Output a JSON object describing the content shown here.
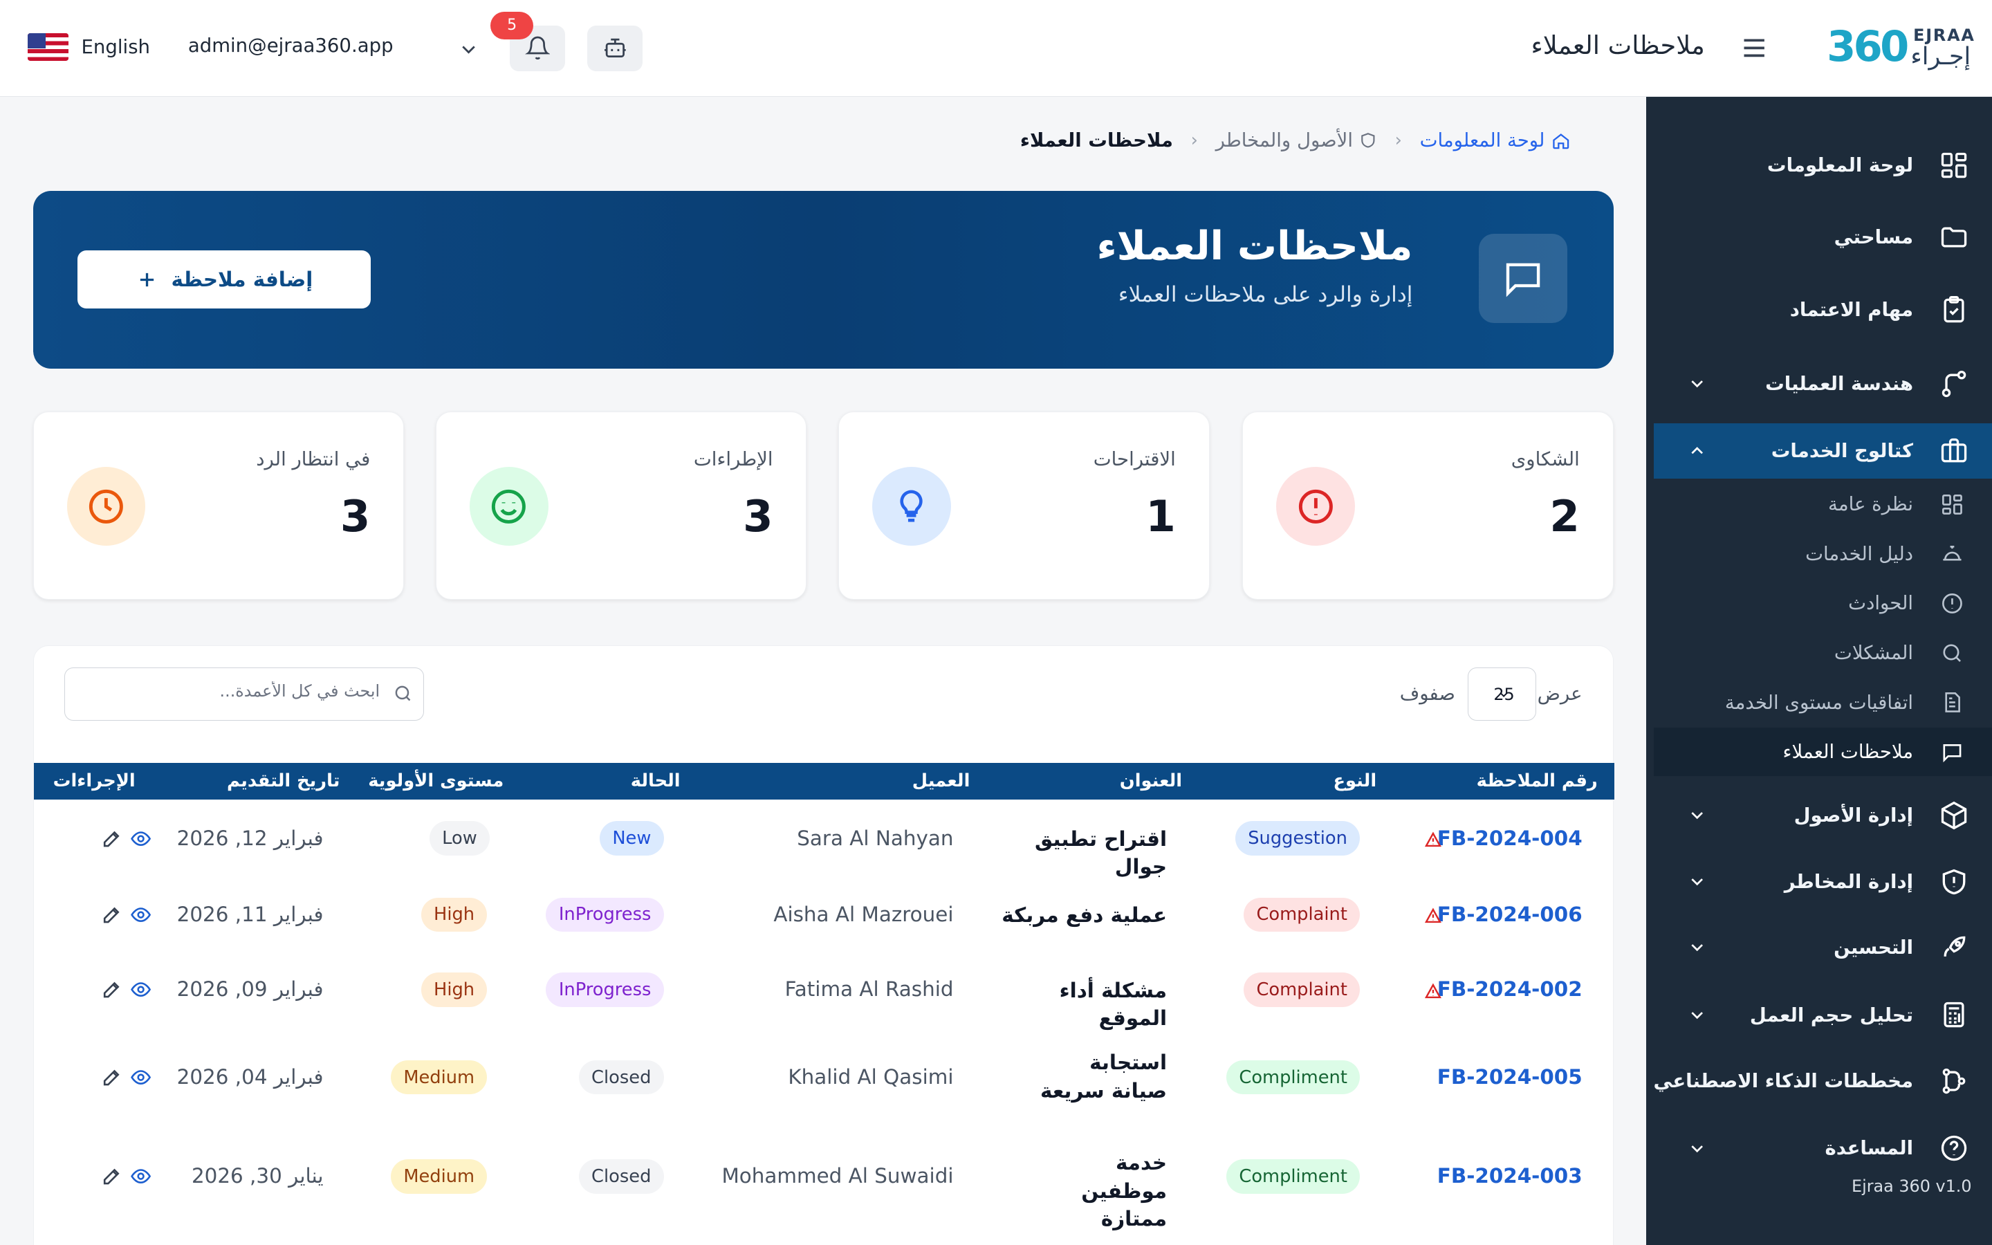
{
  "header": {
    "language": "English",
    "user_email": "admin@ejraa360.app",
    "notifications_count": "5",
    "page_title": "ملاحظات العملاء",
    "logo": {
      "number": "360",
      "en": "EJRAA",
      "ar": "إجـراء"
    }
  },
  "breadcrumb": {
    "home": "لوحة المعلومات",
    "middle": "الأصول والمخاطر",
    "current": "ملاحظات العملاء"
  },
  "hero": {
    "title": "ملاحظات العملاء",
    "subtitle": "إدارة والرد على ملاحظات العملاء",
    "add_button": "إضافة ملاحظة"
  },
  "stats": [
    {
      "label": "الشكاوى",
      "value": "2",
      "icon": "alert-circle-icon",
      "color": "#dc2626",
      "bg": "#fee2e2"
    },
    {
      "label": "الاقتراحات",
      "value": "1",
      "icon": "lightbulb-icon",
      "color": "#2563eb",
      "bg": "#dbeafe"
    },
    {
      "label": "الإطراءات",
      "value": "3",
      "icon": "smile-icon",
      "color": "#16a34a",
      "bg": "#dcfce7"
    },
    {
      "label": "في انتظار الرد",
      "value": "3",
      "icon": "clock-icon",
      "color": "#ea580c",
      "bg": "#ffedd5"
    }
  ],
  "table": {
    "show_label": "عرض",
    "rows_per_page": "25",
    "rows_label": "صفوف",
    "search_placeholder": "ابحث في كل الأعمدة...",
    "columns": [
      "رقم الملاحظة",
      "النوع",
      "العنوان",
      "العميل",
      "الحالة",
      "مستوى الأولوية",
      "تاريخ التقديم",
      "الإجراءات"
    ],
    "rows": [
      {
        "id": "FB-2024-004",
        "warning": true,
        "type": "Suggestion",
        "title": "اقتراح تطبيق جوال",
        "client": "Sara Al Nahyan",
        "status": "New",
        "priority": "Low",
        "date": "فبراير 12, 2026"
      },
      {
        "id": "FB-2024-006",
        "warning": true,
        "type": "Complaint",
        "title": "عملية دفع مربكة",
        "client": "Aisha Al Mazrouei",
        "status": "InProgress",
        "priority": "High",
        "date": "فبراير 11, 2026"
      },
      {
        "id": "FB-2024-002",
        "warning": true,
        "type": "Complaint",
        "title": "مشكلة أداء الموقع",
        "client": "Fatima Al Rashid",
        "status": "InProgress",
        "priority": "High",
        "date": "فبراير 09, 2026"
      },
      {
        "id": "FB-2024-005",
        "warning": false,
        "type": "Compliment",
        "title": "استجابة صيانة سريعة",
        "client": "Khalid Al Qasimi",
        "status": "Closed",
        "priority": "Medium",
        "date": "فبراير 04, 2026"
      },
      {
        "id": "FB-2024-003",
        "warning": false,
        "type": "Compliment",
        "title": "خدمة موظفين ممتازة",
        "client": "Mohammed Al Suwaidi",
        "status": "Closed",
        "priority": "Medium",
        "date": "يناير 30, 2026"
      }
    ]
  },
  "sidebar": {
    "items": [
      {
        "label": "لوحة المعلومات",
        "icon": "dashboard-icon"
      },
      {
        "label": "مساحتي",
        "icon": "folder-icon"
      },
      {
        "label": "مهام الاعتماد",
        "icon": "clipboard-check-icon"
      },
      {
        "label": "هندسة العمليات",
        "icon": "workflow-icon"
      },
      {
        "label": "كتالوج الخدمات",
        "icon": "briefcase-icon"
      },
      {
        "label": "إدارة الأصول",
        "icon": "box-icon"
      },
      {
        "label": "إدارة المخاطر",
        "icon": "shield-icon"
      },
      {
        "label": "التحسين",
        "icon": "rocket-icon"
      },
      {
        "label": "تحليل حجم العمل",
        "icon": "calculator-icon"
      },
      {
        "label": "مخططات الذكاء الاصطناعي",
        "icon": "ai-diagram-icon"
      },
      {
        "label": "المساعدة",
        "icon": "help-icon"
      }
    ],
    "subitems": [
      {
        "label": "نظرة عامة",
        "icon": "grid-icon"
      },
      {
        "label": "دليل الخدمات",
        "icon": "service-bell-icon"
      },
      {
        "label": "الحوادث",
        "icon": "alert-icon"
      },
      {
        "label": "المشكلات",
        "icon": "search-icon"
      },
      {
        "label": "اتفاقيات مستوى الخدمة",
        "icon": "document-icon"
      },
      {
        "label": "ملاحظات العملاء",
        "icon": "message-icon"
      }
    ],
    "version": "Ejraa 360 v1.0"
  }
}
